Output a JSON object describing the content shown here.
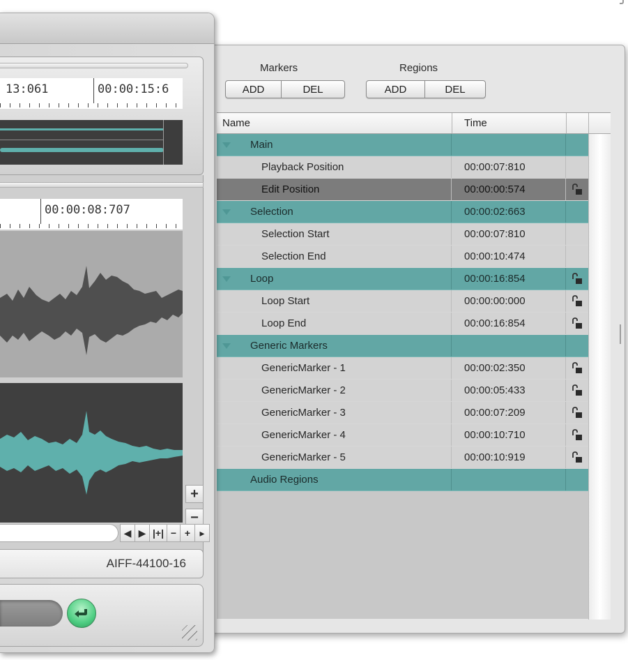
{
  "drawer": {
    "markers_label": "Markers",
    "regions_label": "Regions",
    "markers_add": "ADD",
    "markers_del": "DEL",
    "regions_add": "ADD",
    "regions_del": "DEL",
    "columns": {
      "name": "Name",
      "time": "Time"
    },
    "rows": [
      {
        "type": "group",
        "name": "Main",
        "time": "",
        "lock": false
      },
      {
        "type": "item",
        "name": "Playback Position",
        "time": "00:00:07:810",
        "lock": false
      },
      {
        "type": "item",
        "name": "Edit Position",
        "time": "00:00:00:574",
        "lock": true,
        "selected": true
      },
      {
        "type": "group",
        "name": "Selection",
        "time": "00:00:02:663",
        "lock": false
      },
      {
        "type": "item",
        "name": "Selection Start",
        "time": "00:00:07:810",
        "lock": false
      },
      {
        "type": "item",
        "name": "Selection End",
        "time": "00:00:10:474",
        "lock": false
      },
      {
        "type": "group",
        "name": "Loop",
        "time": "00:00:16:854",
        "lock": true
      },
      {
        "type": "item",
        "name": "Loop Start",
        "time": "00:00:00:000",
        "lock": true
      },
      {
        "type": "item",
        "name": "Loop End",
        "time": "00:00:16:854",
        "lock": true
      },
      {
        "type": "group",
        "name": "Generic Markers",
        "time": "",
        "lock": false
      },
      {
        "type": "item",
        "name": "GenericMarker - 1",
        "time": "00:00:02:350",
        "lock": true
      },
      {
        "type": "item",
        "name": "GenericMarker - 2",
        "time": "00:00:05:433",
        "lock": true
      },
      {
        "type": "item",
        "name": "GenericMarker - 3",
        "time": "00:00:07:209",
        "lock": true
      },
      {
        "type": "item",
        "name": "GenericMarker - 4",
        "time": "00:00:10:710",
        "lock": true
      },
      {
        "type": "item",
        "name": "GenericMarker - 5",
        "time": "00:00:10:919",
        "lock": true
      },
      {
        "type": "group",
        "name": "Audio Regions",
        "time": "",
        "lock": false,
        "no_triangle": true
      }
    ]
  },
  "editor": {
    "overview_ruler": {
      "left": "13:061",
      "right": "00:00:15:6"
    },
    "main_ruler": "00:00:08:707",
    "zoom_in": "+",
    "zoom_out": "−",
    "nav": {
      "prev": "◀",
      "next": "▶",
      "fit": "|+|",
      "minus": "−",
      "plus": "+",
      "more": "▸"
    },
    "format": "AIFF-44100-16"
  },
  "colors": {
    "group_row": "#62a7a5",
    "selected_row": "#7c7c7c",
    "accent_green": "#4fce83"
  }
}
